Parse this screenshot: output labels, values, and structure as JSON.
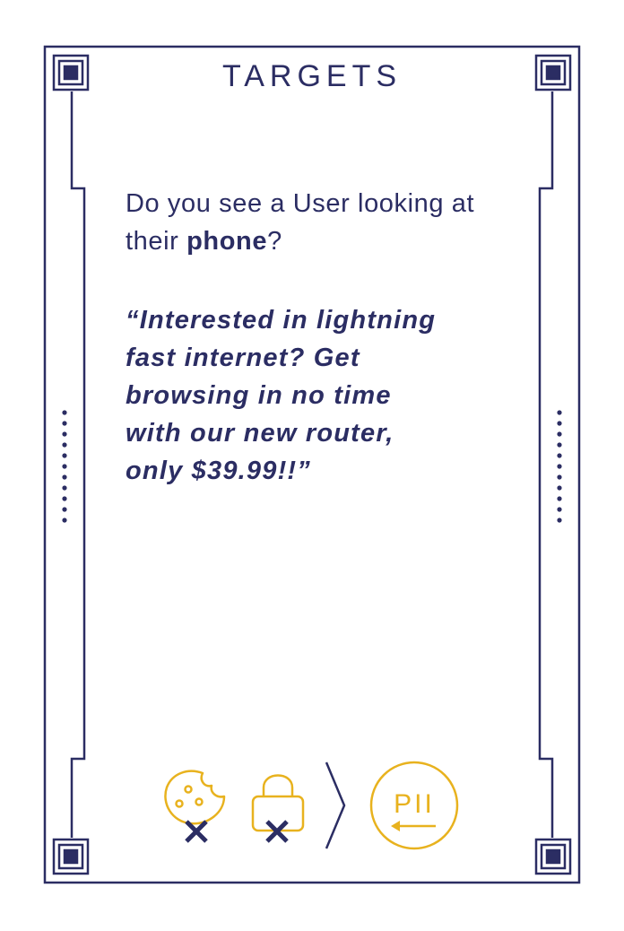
{
  "card": {
    "title": "TARGETS",
    "prompt": {
      "before": "Do you see a User looking at their ",
      "highlight": "phone",
      "after": "?"
    },
    "quote_lines": [
      "“Interested in lightning",
      "fast internet? Get",
      "browsing in no time",
      "with our new router,",
      "only $39.99!!”"
    ],
    "icons": {
      "cookie": "cookie-icon",
      "lock": "lock-icon",
      "cross": "cross-icon",
      "arrow": "chevron-right-icon",
      "pii_badge": "pii-badge-icon",
      "pii_label": "PII"
    }
  },
  "colors": {
    "navy": "#2b2d63",
    "gold": "#e8b21e",
    "background": "#ffffff"
  }
}
